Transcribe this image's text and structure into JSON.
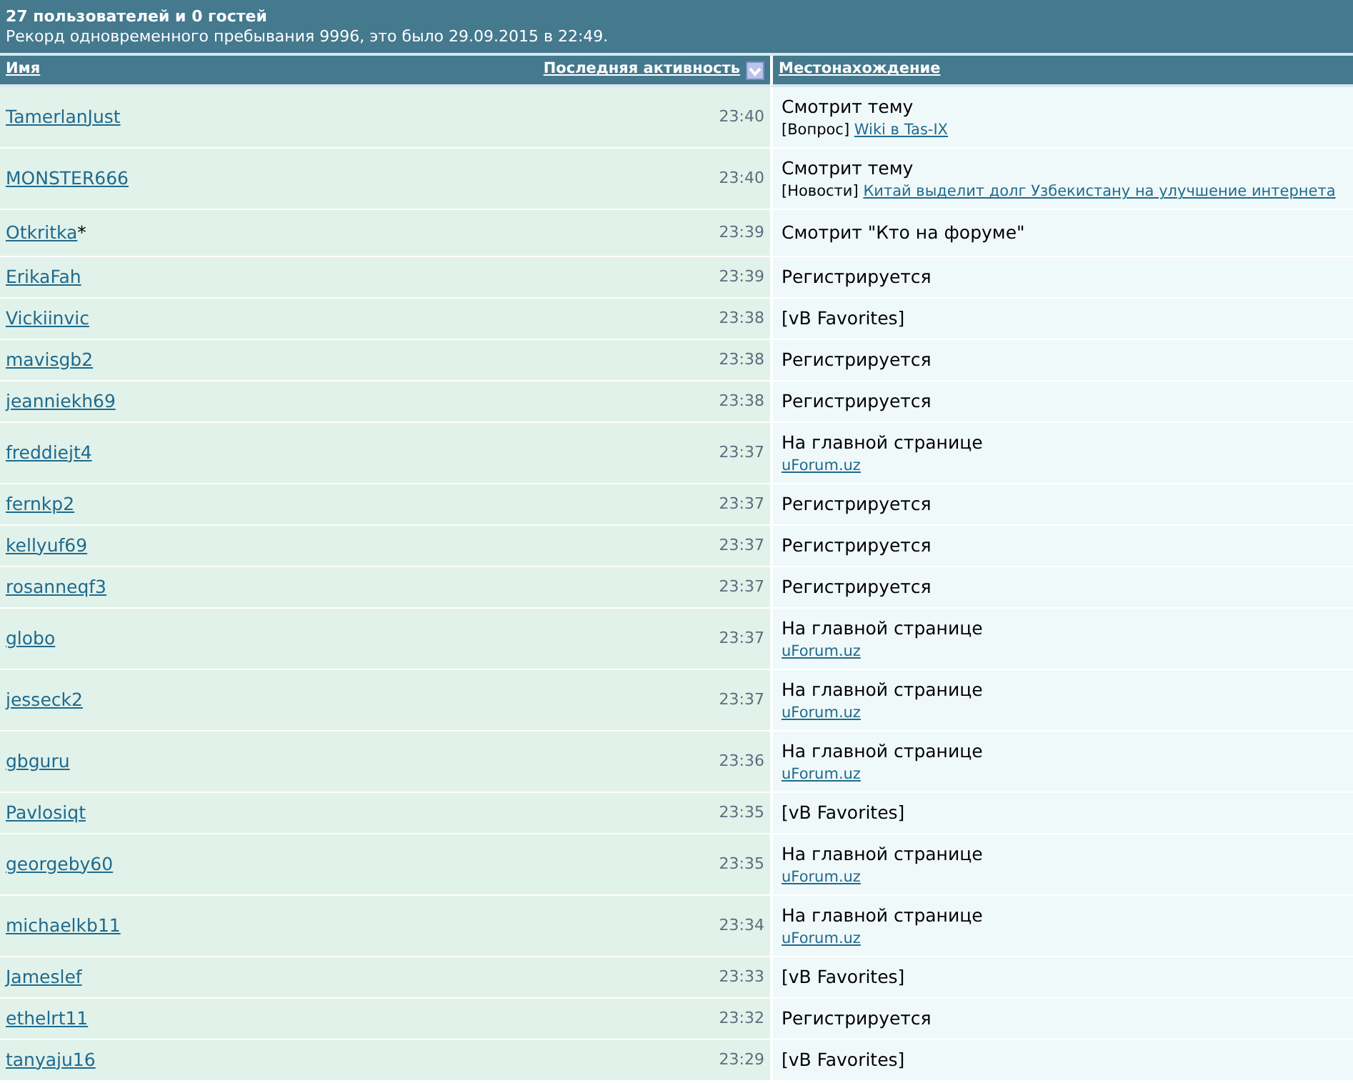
{
  "header": {
    "title": "27 пользователей и 0 гостей",
    "record": "Рекорд одновременного пребывания 9996, это было 29.09.2015 в 22:49."
  },
  "columns": [
    {
      "label": "Имя",
      "sorted": false
    },
    {
      "label": "Последняя активность",
      "sorted": true
    },
    {
      "label": "Местонахождение",
      "sorted": false
    }
  ],
  "rows": [
    {
      "user": "TamerlanJust",
      "time": "23:40",
      "location": "Смотрит тему",
      "detail": {
        "tag": "[Вопрос]",
        "link": "Wiki в Tas-IX"
      }
    },
    {
      "user": "MONSTER666",
      "time": "23:40",
      "location": "Смотрит тему",
      "detail": {
        "tag": "[Новости]",
        "link": "Китай выделит долг Узбекистану на улучшение интернета"
      }
    },
    {
      "user": "Otkritka",
      "suffix": "*",
      "time": "23:39",
      "location": "Смотрит \"Кто на форуме\""
    },
    {
      "user": "ErikaFah",
      "time": "23:39",
      "location": "Регистрируется"
    },
    {
      "user": "Vickiinvic",
      "time": "23:38",
      "location": "[vB Favorites]"
    },
    {
      "user": "mavisgb2",
      "time": "23:38",
      "location": "Регистрируется"
    },
    {
      "user": "jeanniekh69",
      "time": "23:38",
      "location": "Регистрируется"
    },
    {
      "user": "freddiejt4",
      "time": "23:37",
      "location": "На главной странице",
      "detail": {
        "link": "uForum.uz"
      }
    },
    {
      "user": "fernkp2",
      "time": "23:37",
      "location": "Регистрируется"
    },
    {
      "user": "kellyuf69",
      "time": "23:37",
      "location": "Регистрируется"
    },
    {
      "user": "rosanneqf3",
      "time": "23:37",
      "location": "Регистрируется"
    },
    {
      "user": "globo",
      "time": "23:37",
      "location": "На главной странице",
      "detail": {
        "link": "uForum.uz"
      }
    },
    {
      "user": "jesseck2",
      "time": "23:37",
      "location": "На главной странице",
      "detail": {
        "link": "uForum.uz"
      }
    },
    {
      "user": "gbguru",
      "time": "23:36",
      "location": "На главной странице",
      "detail": {
        "link": "uForum.uz"
      }
    },
    {
      "user": "Pavlosiqt",
      "time": "23:35",
      "location": "[vB Favorites]"
    },
    {
      "user": "georgeby60",
      "time": "23:35",
      "location": "На главной странице",
      "detail": {
        "link": "uForum.uz"
      }
    },
    {
      "user": "michaelkb11",
      "time": "23:34",
      "location": "На главной странице",
      "detail": {
        "link": "uForum.uz"
      }
    },
    {
      "user": "Jameslef",
      "time": "23:33",
      "location": "[vB Favorites]"
    },
    {
      "user": "ethelrt11",
      "time": "23:32",
      "location": "Регистрируется"
    },
    {
      "user": "tanyaju16",
      "time": "23:29",
      "location": "[vB Favorites]"
    }
  ]
}
